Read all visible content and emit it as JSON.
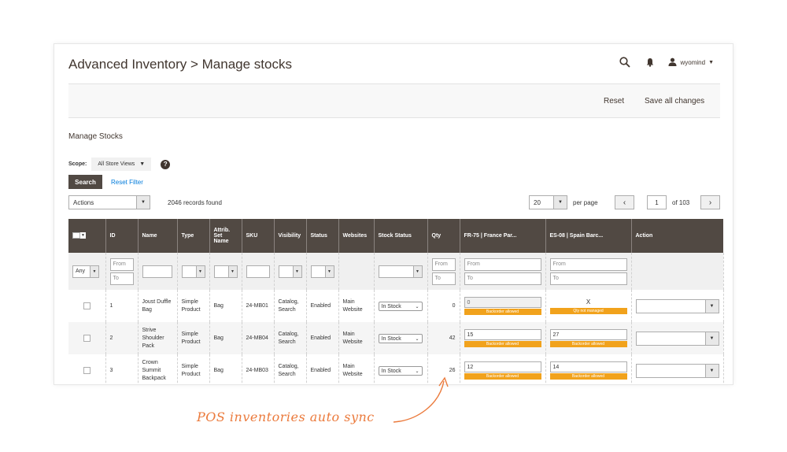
{
  "header": {
    "title": "Advanced Inventory > Manage stocks",
    "user_name": "wyomind",
    "icons": [
      "search-icon",
      "bell-icon",
      "user-icon"
    ]
  },
  "action_bar": {
    "reset_label": "Reset",
    "save_label": "Save all changes"
  },
  "section": {
    "title": "Manage Stocks"
  },
  "scope": {
    "label": "Scope:",
    "value": "All Store Views"
  },
  "filters": {
    "search_label": "Search",
    "reset_filter_label": "Reset Filter"
  },
  "toolbar": {
    "actions_value": "Actions",
    "records_found": "2046 records found",
    "per_page_value": "20",
    "per_page_label": "per page",
    "current_page": "1",
    "total_pages": "of 103"
  },
  "grid": {
    "columns": [
      "ID",
      "Name",
      "Type",
      "Attrib. Set Name",
      "SKU",
      "Visibility",
      "Status",
      "Websites",
      "Stock Status",
      "Qty",
      "FR-75 | France Par...",
      "ES-08 | Spain Barc...",
      "Action"
    ],
    "filter_any": "Any",
    "from_placeholder": "From",
    "to_placeholder": "To",
    "rows": [
      {
        "id": "1",
        "name": "Joust Duffle Bag",
        "type": "Simple Product",
        "attr_set": "Bag",
        "sku": "24-MB01",
        "visibility": "Catalog, Search",
        "status": "Enabled",
        "websites": "Main Website",
        "stock_status": "In Stock",
        "qty": "0",
        "fr_value": "0",
        "fr_badge": "Backorder allowed",
        "es_value": "X",
        "es_badge": "Qty not managed"
      },
      {
        "id": "2",
        "name": "Strive Shoulder Pack",
        "type": "Simple Product",
        "attr_set": "Bag",
        "sku": "24-MB04",
        "visibility": "Catalog, Search",
        "status": "Enabled",
        "websites": "Main Website",
        "stock_status": "In Stock",
        "qty": "42",
        "fr_value": "15",
        "fr_badge": "Backorder allowed",
        "es_value": "27",
        "es_badge": "Backorder allowed"
      },
      {
        "id": "3",
        "name": "Crown Summit Backpack",
        "type": "Simple Product",
        "attr_set": "Bag",
        "sku": "24-MB03",
        "visibility": "Catalog, Search",
        "status": "Enabled",
        "websites": "Main Website",
        "stock_status": "In Stock",
        "qty": "26",
        "fr_value": "12",
        "fr_badge": "Backorder allowed",
        "es_value": "14",
        "es_badge": "Backorder allowed"
      }
    ]
  },
  "annotation": {
    "text": "POS inventories auto sync",
    "color": "#eb7a3c"
  },
  "colors": {
    "header_bg": "#514943",
    "badge": "#f1a21c",
    "link": "#007bdb"
  }
}
